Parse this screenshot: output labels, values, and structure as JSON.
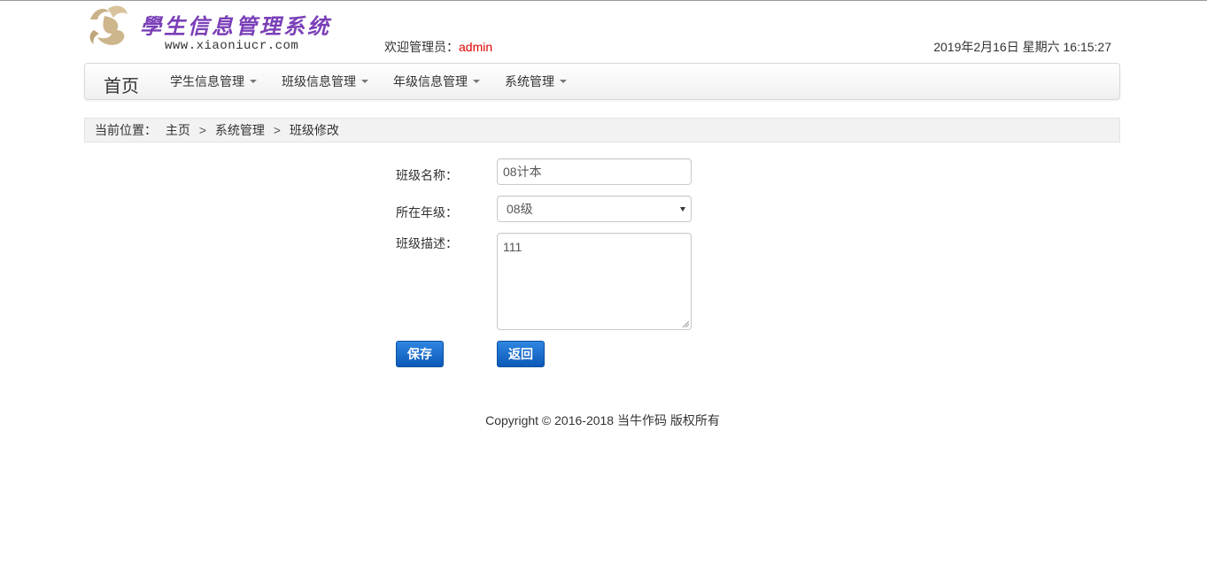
{
  "header": {
    "logo_title": "學生信息管理系统",
    "logo_url": "www.xiaoniucr.com",
    "welcome_prefix": "欢迎管理员：",
    "username": "admin",
    "datetime": "2019年2月16日 星期六 16:15:27"
  },
  "navbar": {
    "brand": "首页",
    "items": [
      {
        "label": "学生信息管理"
      },
      {
        "label": "班级信息管理"
      },
      {
        "label": "年级信息管理"
      },
      {
        "label": "系统管理"
      }
    ]
  },
  "breadcrumb": {
    "prefix": "当前位置：",
    "items": [
      "主页",
      "系统管理",
      "班级修改"
    ],
    "separator": ">"
  },
  "form": {
    "class_name_label": "班级名称：",
    "class_name_value": "08计本",
    "grade_label": "所在年级：",
    "grade_selected": "08级",
    "description_label": "班级描述：",
    "description_value": "111",
    "save_label": "保存",
    "back_label": "返回"
  },
  "footer": {
    "copyright": "Copyright © 2016-2018 当牛作码 版权所有"
  },
  "colors": {
    "accent_button": "#1a6fd0",
    "username": "#e00000",
    "logo_title": "#7a3fb8"
  }
}
